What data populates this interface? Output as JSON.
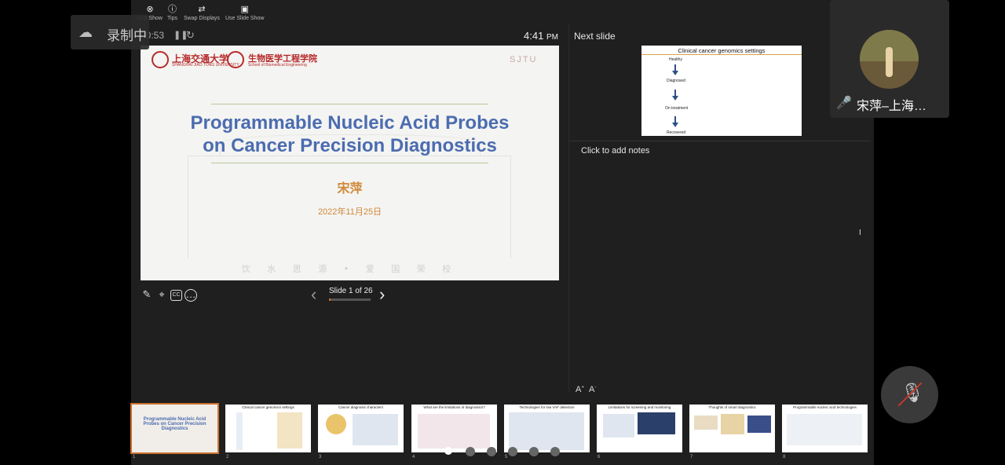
{
  "toolbar": {
    "end_show": "End Show",
    "tips": "Tips",
    "swap_displays": "Swap Displays",
    "use_slide_show": "Use Slide Show"
  },
  "recording": {
    "label": "录制中"
  },
  "timer": "00:53",
  "clock": {
    "time": "4:41",
    "ampm": "PM"
  },
  "current_slide": {
    "university_cn": "上海交通大学",
    "university_en": "SHANGHAI JIAO TONG UNIVERSITY",
    "school_cn": "生物医学工程学院",
    "school_en": "School of Biomedical Engineering",
    "brand_mark": "SJTU",
    "title_line1": "Programmable Nucleic Acid Probes",
    "title_line2": "on Cancer Precision Diagnostics",
    "author": "宋萍",
    "date": "2022年11月25日",
    "motto": "饮 水 思 源 • 爱 国 荣 校"
  },
  "slide_nav": {
    "counter": "Slide 1 of 26",
    "progress": 0.0385
  },
  "next_slide": {
    "label": "Next slide",
    "title": "Clinical cancer genomics settings",
    "steps": [
      "Healthy",
      "Diagnosed",
      "On treatment",
      "Recovered"
    ]
  },
  "notes": {
    "placeholder": "Click to add notes"
  },
  "thumbnails": [
    {
      "num": "1",
      "title": "Programmable Nucleic Acid Probes on Cancer Precision Diagnostics"
    },
    {
      "num": "2",
      "title": "Clinical cancer genomics settings"
    },
    {
      "num": "3",
      "title": "Cancer diagnosis characters"
    },
    {
      "num": "4",
      "title": "What are the limitations of diagnostics?"
    },
    {
      "num": "5",
      "title": "Technologies for low VAF detection"
    },
    {
      "num": "6",
      "title": "Limitations for screening and monitoring"
    },
    {
      "num": "7",
      "title": "Thoughts of smart diagnostics"
    },
    {
      "num": "8",
      "title": "Programmable nucleic acid technologies"
    }
  ],
  "participant": {
    "name": "宋萍–上海…"
  },
  "colors": {
    "accent": "#c8702e",
    "title_blue": "#4b6cb0",
    "author_orange": "#d0893a"
  }
}
